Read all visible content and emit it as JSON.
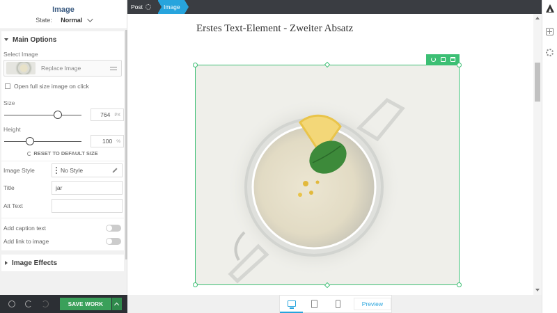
{
  "panel": {
    "title": "Image",
    "state_label": "State:",
    "state_value": "Normal",
    "main_options": {
      "title": "Main Options",
      "select_image_label": "Select Image",
      "replace_image": "Replace Image",
      "open_full_size": "Open full size image on click",
      "size_label": "Size",
      "size_value": "764",
      "size_unit": "PX",
      "size_level": 0.69,
      "height_label": "Height",
      "height_value": "100",
      "height_unit": "%",
      "height_level": 0.33,
      "reset_label": "RESET TO DEFAULT SIZE",
      "image_style_label": "Image Style",
      "image_style_value": "No Style",
      "title_label": "Title",
      "title_value": "jar",
      "alt_label": "Alt Text",
      "alt_value": "",
      "caption_label": "Add caption text",
      "link_label": "Add link to image"
    },
    "image_effects": "Image Effects",
    "save_label": "SAVE WORK"
  },
  "breadcrumb": {
    "post": "Post",
    "image": "Image"
  },
  "canvas": {
    "heading": "Erstes Text-Element - Zweiter Absatz"
  },
  "devices": {
    "preview": "Preview"
  },
  "colors": {
    "accent": "#27a4dd",
    "selection": "#3cbf74",
    "save": "#3aa05a",
    "topbar": "#3a3d42"
  }
}
